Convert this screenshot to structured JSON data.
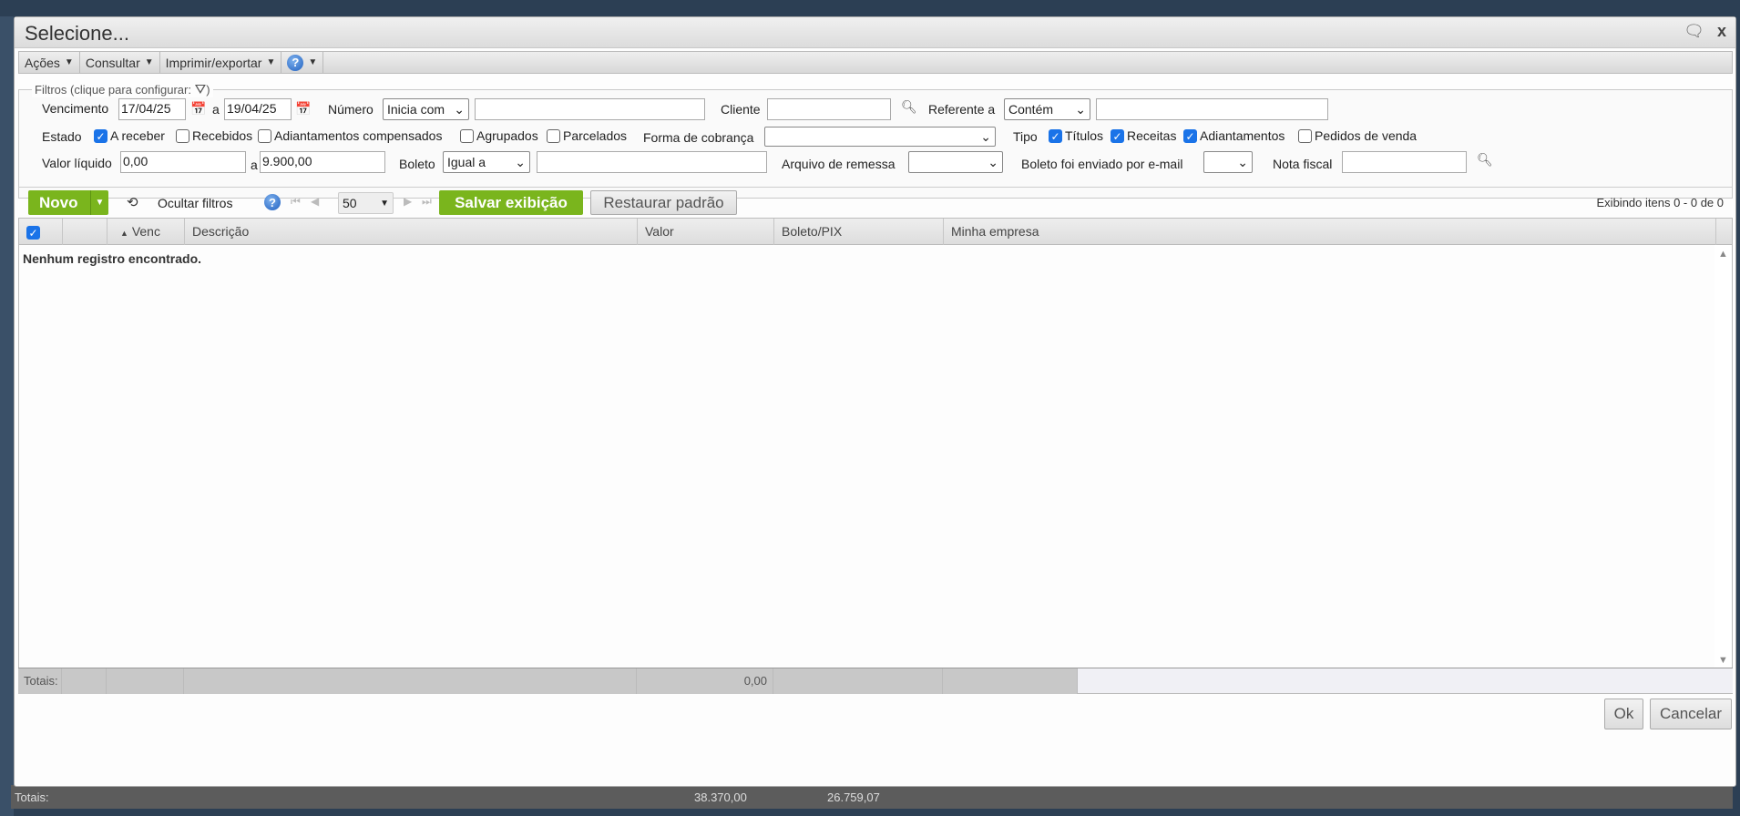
{
  "background": {
    "totals_label": "Totais:",
    "total_1": "38.370,00",
    "total_2": "26.759,07"
  },
  "dialog": {
    "title": "Selecione...",
    "chat_icon": "speech-bubble-icon",
    "close_label": "x"
  },
  "menu": {
    "items": [
      {
        "label": "Ações"
      },
      {
        "label": "Consultar"
      },
      {
        "label": "Imprimir/exportar"
      }
    ],
    "help": "?"
  },
  "filters": {
    "legend": "Filtros (clique para configurar:",
    "legend_end": ")",
    "vencimento": {
      "label": "Vencimento",
      "from": "17/04/25",
      "sep": "a",
      "to": "19/04/25"
    },
    "numero": {
      "label": "Número",
      "operator": "Inicia com",
      "value": ""
    },
    "cliente": {
      "label": "Cliente",
      "value": ""
    },
    "referente": {
      "label": "Referente a",
      "operator": "Contém",
      "value": ""
    },
    "estado": {
      "label": "Estado",
      "options": [
        {
          "label": "A receber",
          "checked": true
        },
        {
          "label": "Recebidos",
          "checked": false
        },
        {
          "label": "Adiantamentos compensados",
          "checked": false
        },
        {
          "label": "Agrupados",
          "checked": false
        },
        {
          "label": "Parcelados",
          "checked": false
        }
      ]
    },
    "forma_cobranca": {
      "label": "Forma de cobrança",
      "value": ""
    },
    "tipo": {
      "label": "Tipo",
      "options": [
        {
          "label": "Títulos",
          "checked": true
        },
        {
          "label": "Receitas",
          "checked": true
        },
        {
          "label": "Adiantamentos",
          "checked": true
        },
        {
          "label": "Pedidos de venda",
          "checked": false
        }
      ]
    },
    "valor_liquido": {
      "label": "Valor líquido",
      "from": "0,00",
      "sep": "a",
      "to": "9.900,00"
    },
    "boleto": {
      "label": "Boleto",
      "operator": "Igual a",
      "value": ""
    },
    "arquivo_remessa": {
      "label": "Arquivo de remessa",
      "value": ""
    },
    "boleto_email": {
      "label": "Boleto foi enviado por e-mail",
      "value": ""
    },
    "nota_fiscal": {
      "label": "Nota fiscal",
      "value": ""
    }
  },
  "toolbar": {
    "new_label": "Novo",
    "hide_filters": "Ocultar filtros",
    "help": "?",
    "page_size": "50",
    "save_view": "Salvar exibição",
    "restore_default": "Restaurar padrão",
    "showing": "Exibindo itens 0 - 0 de 0"
  },
  "grid": {
    "columns": [
      "",
      "",
      "Venc",
      "Descrição",
      "Valor",
      "Boleto/PIX",
      "Minha empresa"
    ],
    "sort_indicator": "▲",
    "empty_message": "Nenhum registro encontrado.",
    "totals_label": "Totais:",
    "totals_valor": "0,00"
  },
  "footer": {
    "ok": "Ok",
    "cancel": "Cancelar"
  },
  "colors": {
    "accent_green": "#7ab51d",
    "checkbox_blue": "#1a73e8",
    "background_navy": "#2c3f54"
  }
}
